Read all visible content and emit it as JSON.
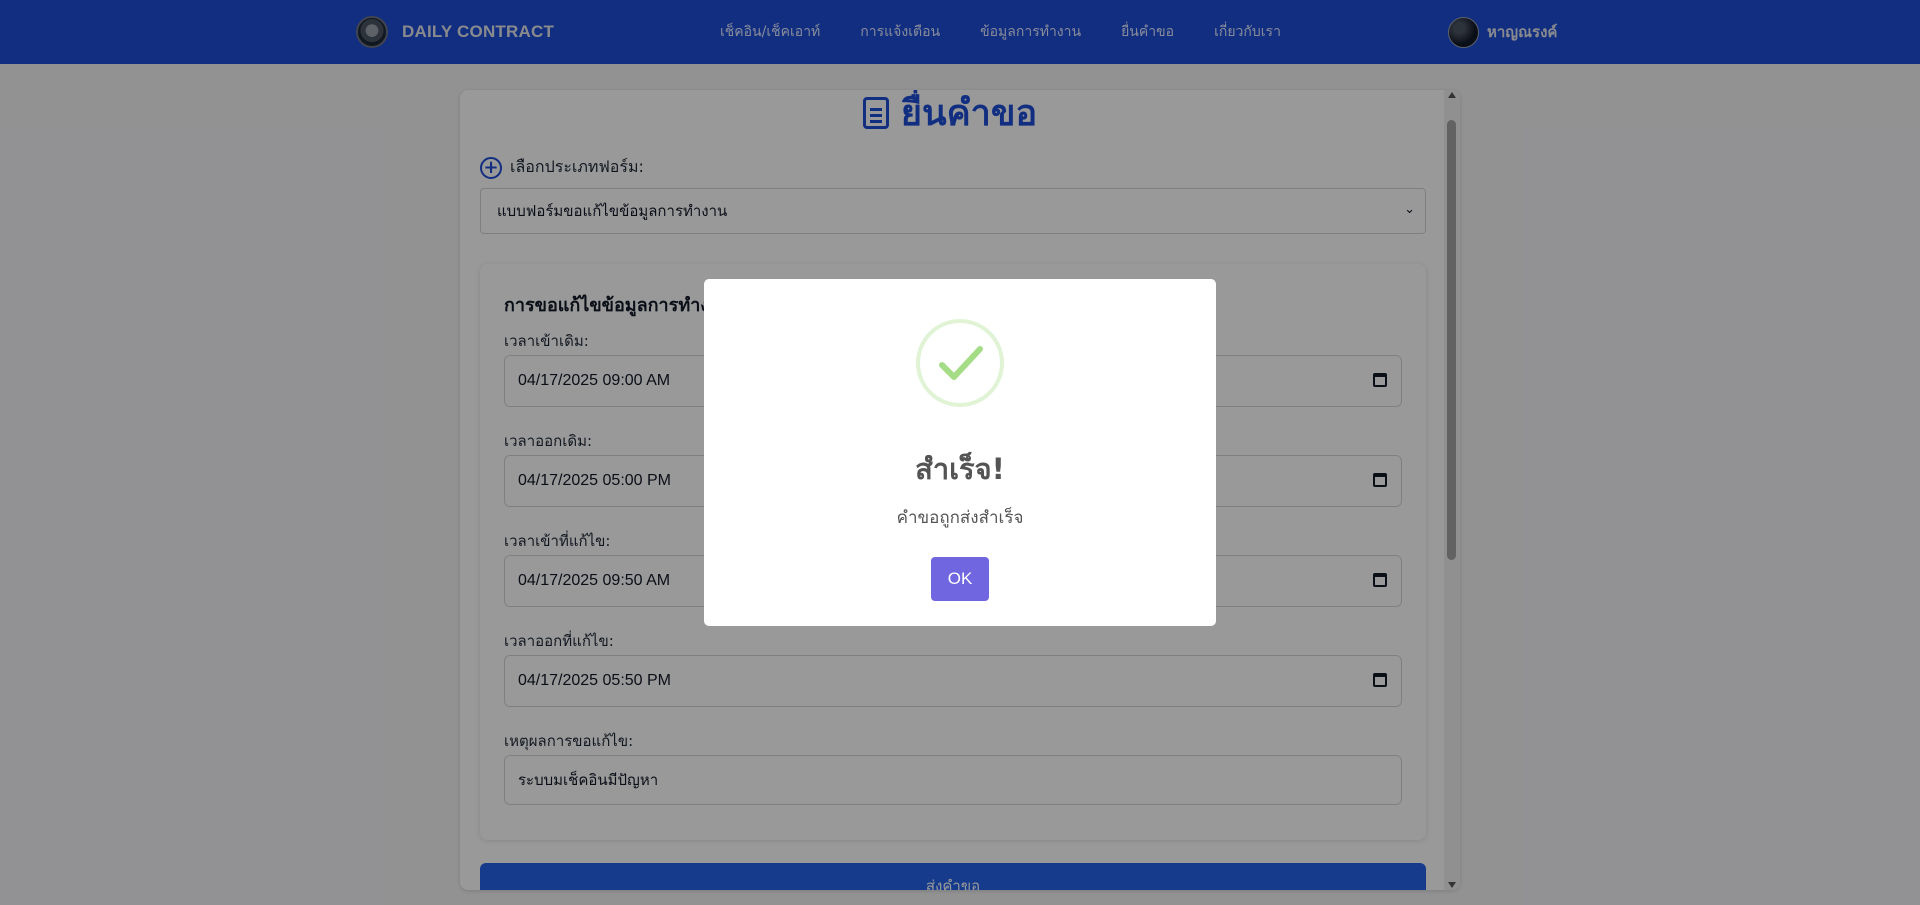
{
  "navbar": {
    "brand": "DAILY CONTRACT",
    "links": [
      "เช็คอิน/เช็คเอาท์",
      "การแจ้งเตือน",
      "ข้อมูลการทำงาน",
      "ยื่นคำขอ",
      "เกี่ยวกับเรา"
    ],
    "user_name": "หาญณรงค์"
  },
  "page": {
    "title": "ยื่นคำขอ",
    "form_type_label": "เลือกประเภทฟอร์ม:",
    "form_type_selected": "แบบฟอร์มขอแก้ไขข้อมูลการทำงาน",
    "subform_title": "การขอแก้ไขข้อมูลการทำงาน",
    "fields": [
      {
        "label": "เวลาเข้าเดิม:",
        "value": "04/17/2025 09:00 AM"
      },
      {
        "label": "เวลาออกเดิม:",
        "value": "04/17/2025 05:00 PM"
      },
      {
        "label": "เวลาเข้าที่แก้ไข:",
        "value": "04/17/2025 09:50 AM"
      },
      {
        "label": "เวลาออกที่แก้ไข:",
        "value": "04/17/2025 05:50 PM"
      }
    ],
    "reason_label": "เหตุผลการขอแก้ไข:",
    "reason_value": "ระบบมเช็คอินมีปัญหา",
    "submit_label": "ส่งคำขอ"
  },
  "modal": {
    "title": "สำเร็จ!",
    "text": "คำขอถูกส่งสำเร็จ",
    "ok_label": "OK",
    "icon": "success-check-icon"
  },
  "colors": {
    "navbar": "#1d4ed8",
    "accent": "#2563eb",
    "ok_button": "#7066e0",
    "success": "#a5dc86"
  }
}
